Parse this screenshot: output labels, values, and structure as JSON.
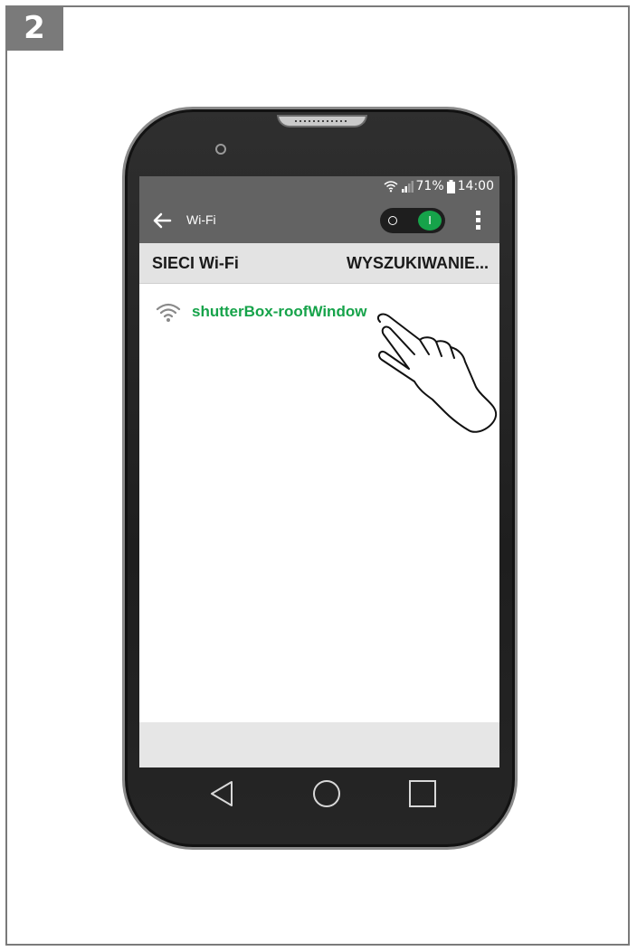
{
  "step": "2",
  "status_bar": {
    "battery": "71%",
    "time": "14:00"
  },
  "app_bar": {
    "title": "Wi-Fi",
    "toggle_state": "I"
  },
  "section": {
    "title": "SIECI Wi-Fi",
    "status": "WYSZUKIWANIE..."
  },
  "networks": [
    {
      "name": "shutterBox-roofWindow"
    }
  ],
  "colors": {
    "accent": "#16a34a",
    "bar": "#636363",
    "header": "#e3e3e3"
  },
  "icons": {
    "back": "arrow-left-icon",
    "wifi": "wifi-icon",
    "menu": "more-vert-icon",
    "nav_back": "triangle-back-icon",
    "nav_home": "circle-home-icon",
    "nav_recent": "square-recent-icon"
  }
}
